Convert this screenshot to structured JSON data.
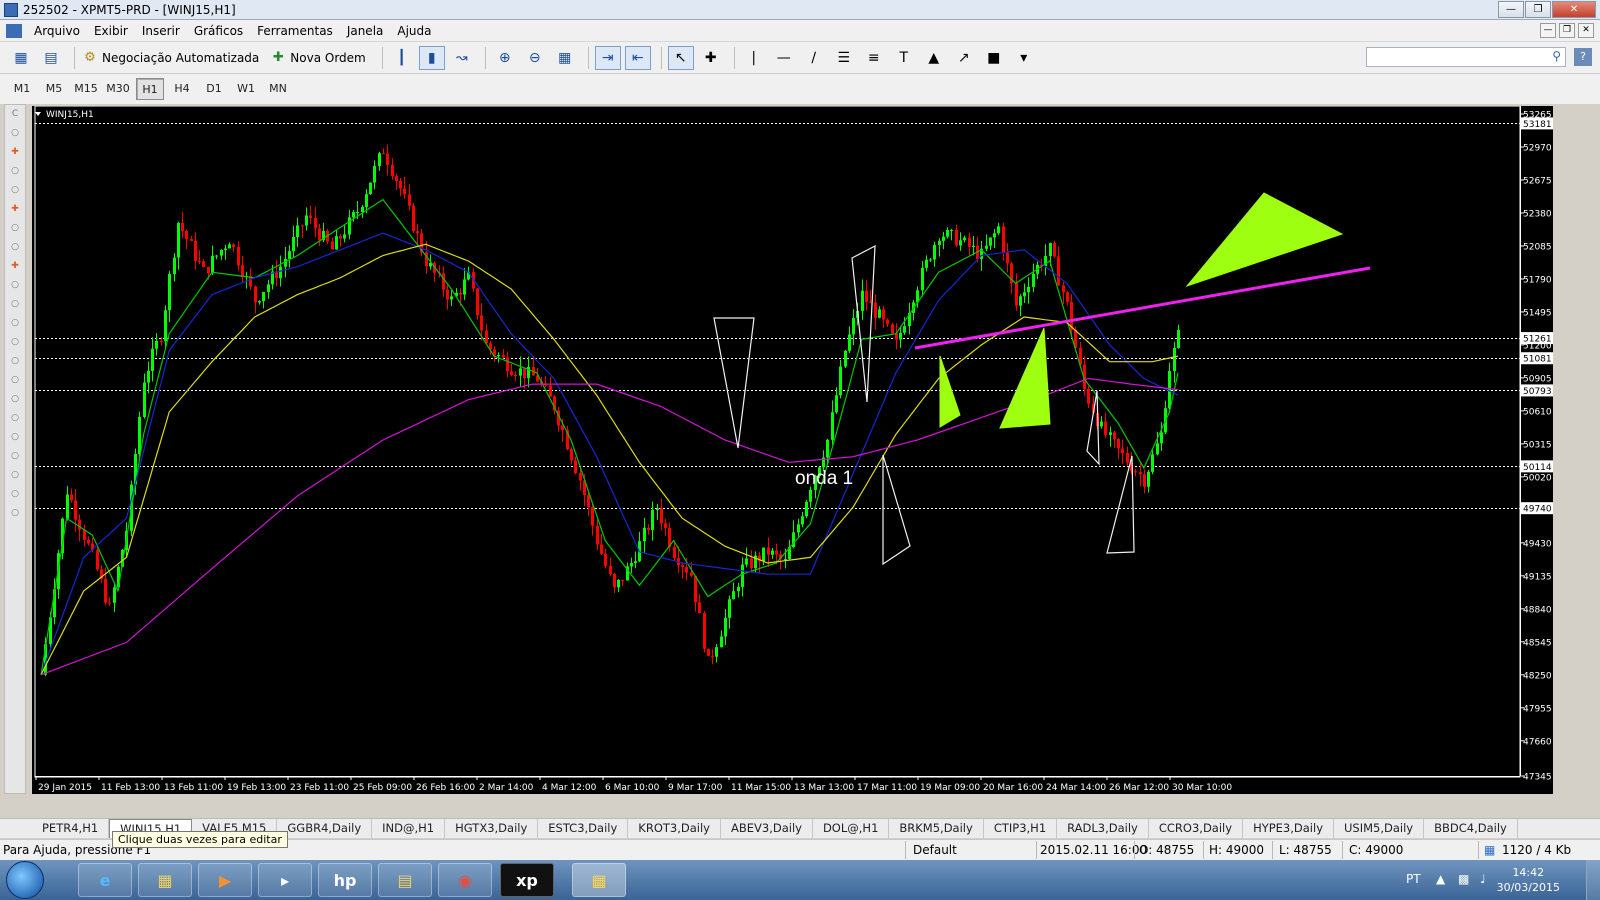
{
  "window": {
    "title": "252502 - XPMT5-PRD - [WINJ15,H1]"
  },
  "menu": [
    "Arquivo",
    "Exibir",
    "Inserir",
    "Gráficos",
    "Ferramentas",
    "Janela",
    "Ajuda"
  ],
  "toolbar": {
    "auto_trading": "Negociação Automatizada",
    "new_order": "Nova Ordem"
  },
  "timeframes": [
    "M1",
    "M5",
    "M15",
    "M30",
    "H1",
    "H4",
    "D1",
    "W1",
    "MN"
  ],
  "active_timeframe": "H1",
  "chart_data": {
    "type": "candlestick",
    "title": "WINJ15,H1",
    "symbol": "WINJ15",
    "timeframe": "H1",
    "ylim": [
      47345,
      53265
    ],
    "y_ticks": [
      53265,
      52970,
      52675,
      52380,
      52085,
      51790,
      51495,
      51200,
      50905,
      50610,
      50315,
      50020,
      49725,
      49430,
      49135,
      48840,
      48545,
      48250,
      47955,
      47660,
      47345
    ],
    "price_labels": [
      53181,
      51261,
      51081,
      50793,
      50114,
      49740
    ],
    "x_labels": [
      "29 Jan 2015",
      "11 Feb 13:00",
      "13 Feb 11:00",
      "19 Feb 13:00",
      "23 Feb 11:00",
      "25 Feb 09:00",
      "26 Feb 16:00",
      "2 Mar 14:00",
      "4 Mar 12:00",
      "6 Mar 10:00",
      "9 Mar 17:00",
      "11 Mar 15:00",
      "13 Mar 13:00",
      "17 Mar 11:00",
      "19 Mar 09:00",
      "20 Mar 16:00",
      "24 Mar 14:00",
      "26 Mar 12:00",
      "30 Mar 10:00"
    ],
    "close_path": [
      [
        0,
        48250
      ],
      [
        6,
        49900
      ],
      [
        12,
        49300
      ],
      [
        16,
        48840
      ],
      [
        20,
        49550
      ],
      [
        24,
        50900
      ],
      [
        28,
        51300
      ],
      [
        32,
        52300
      ],
      [
        38,
        51850
      ],
      [
        44,
        52150
      ],
      [
        50,
        51600
      ],
      [
        56,
        51900
      ],
      [
        62,
        52350
      ],
      [
        68,
        52050
      ],
      [
        74,
        52400
      ],
      [
        80,
        52950
      ],
      [
        84,
        52600
      ],
      [
        90,
        51950
      ],
      [
        96,
        51600
      ],
      [
        100,
        51800
      ],
      [
        104,
        51200
      ],
      [
        110,
        51000
      ],
      [
        116,
        50900
      ],
      [
        120,
        50650
      ],
      [
        126,
        50000
      ],
      [
        130,
        49450
      ],
      [
        134,
        49000
      ],
      [
        138,
        49250
      ],
      [
        144,
        49750
      ],
      [
        148,
        49350
      ],
      [
        152,
        49150
      ],
      [
        156,
        48350
      ],
      [
        160,
        48750
      ],
      [
        164,
        49200
      ],
      [
        170,
        49350
      ],
      [
        174,
        49250
      ],
      [
        180,
        49950
      ],
      [
        184,
        50350
      ],
      [
        188,
        51150
      ],
      [
        192,
        51650
      ],
      [
        196,
        51450
      ],
      [
        200,
        51200
      ],
      [
        204,
        51650
      ],
      [
        210,
        52200
      ],
      [
        214,
        52150
      ],
      [
        220,
        52000
      ],
      [
        224,
        52250
      ],
      [
        228,
        51550
      ],
      [
        232,
        51850
      ],
      [
        236,
        52050
      ],
      [
        240,
        51550
      ],
      [
        244,
        50800
      ],
      [
        248,
        50450
      ],
      [
        252,
        50250
      ],
      [
        258,
        50000
      ],
      [
        262,
        50400
      ],
      [
        264,
        51000
      ],
      [
        266,
        51280
      ]
    ],
    "moving_averages": [
      {
        "name": "MA green",
        "color": "#00c800",
        "path": [
          [
            0,
            48250
          ],
          [
            6,
            49650
          ],
          [
            12,
            49500
          ],
          [
            18,
            49000
          ],
          [
            24,
            50400
          ],
          [
            30,
            51300
          ],
          [
            40,
            51850
          ],
          [
            50,
            51800
          ],
          [
            60,
            52000
          ],
          [
            70,
            52250
          ],
          [
            80,
            52500
          ],
          [
            86,
            52200
          ],
          [
            96,
            51700
          ],
          [
            106,
            51100
          ],
          [
            116,
            50950
          ],
          [
            124,
            50350
          ],
          [
            132,
            49450
          ],
          [
            140,
            49050
          ],
          [
            148,
            49450
          ],
          [
            156,
            48950
          ],
          [
            164,
            49150
          ],
          [
            172,
            49250
          ],
          [
            180,
            49600
          ],
          [
            186,
            50400
          ],
          [
            192,
            51250
          ],
          [
            200,
            51300
          ],
          [
            210,
            51850
          ],
          [
            220,
            52050
          ],
          [
            228,
            51750
          ],
          [
            236,
            51950
          ],
          [
            244,
            50900
          ],
          [
            252,
            50500
          ],
          [
            258,
            50100
          ],
          [
            264,
            50600
          ],
          [
            266,
            50950
          ]
        ]
      },
      {
        "name": "MA blue",
        "color": "#1428d2",
        "path": [
          [
            0,
            48250
          ],
          [
            10,
            49300
          ],
          [
            20,
            49650
          ],
          [
            30,
            51150
          ],
          [
            40,
            51650
          ],
          [
            50,
            51800
          ],
          [
            60,
            51900
          ],
          [
            70,
            52050
          ],
          [
            80,
            52200
          ],
          [
            90,
            52050
          ],
          [
            100,
            51850
          ],
          [
            110,
            51300
          ],
          [
            120,
            50900
          ],
          [
            130,
            50200
          ],
          [
            140,
            49350
          ],
          [
            150,
            49250
          ],
          [
            160,
            49200
          ],
          [
            170,
            49150
          ],
          [
            180,
            49150
          ],
          [
            190,
            50050
          ],
          [
            200,
            50950
          ],
          [
            210,
            51600
          ],
          [
            220,
            52000
          ],
          [
            230,
            52050
          ],
          [
            240,
            51750
          ],
          [
            250,
            51200
          ],
          [
            258,
            50900
          ],
          [
            266,
            50750
          ]
        ]
      },
      {
        "name": "MA yellow",
        "color": "#dcdc14",
        "path": [
          [
            0,
            48250
          ],
          [
            10,
            49000
          ],
          [
            20,
            49300
          ],
          [
            30,
            50600
          ],
          [
            40,
            51050
          ],
          [
            50,
            51450
          ],
          [
            60,
            51650
          ],
          [
            70,
            51800
          ],
          [
            80,
            52000
          ],
          [
            90,
            52100
          ],
          [
            100,
            51950
          ],
          [
            110,
            51700
          ],
          [
            120,
            51250
          ],
          [
            130,
            50750
          ],
          [
            140,
            50150
          ],
          [
            150,
            49650
          ],
          [
            160,
            49400
          ],
          [
            170,
            49250
          ],
          [
            180,
            49300
          ],
          [
            190,
            49750
          ],
          [
            200,
            50400
          ],
          [
            210,
            50900
          ],
          [
            220,
            51200
          ],
          [
            230,
            51450
          ],
          [
            240,
            51400
          ],
          [
            250,
            51050
          ],
          [
            260,
            51050
          ],
          [
            266,
            51100
          ]
        ]
      },
      {
        "name": "MA magenta",
        "color": "#d214d2",
        "path": [
          [
            0,
            48250
          ],
          [
            20,
            48540
          ],
          [
            40,
            49200
          ],
          [
            60,
            49850
          ],
          [
            80,
            50350
          ],
          [
            100,
            50710
          ],
          [
            115,
            50850
          ],
          [
            130,
            50850
          ],
          [
            145,
            50650
          ],
          [
            160,
            50350
          ],
          [
            175,
            50150
          ],
          [
            190,
            50200
          ],
          [
            205,
            50350
          ],
          [
            220,
            50550
          ],
          [
            235,
            50750
          ],
          [
            245,
            50900
          ],
          [
            255,
            50850
          ],
          [
            266,
            50800
          ]
        ]
      }
    ],
    "annotations": [
      {
        "type": "text",
        "text": "onda 1"
      },
      {
        "type": "trendline",
        "color": "#f020f0"
      }
    ]
  },
  "symbol_tabs": [
    "PETR4,H1",
    "WINJ15,H1",
    "VALE5,M15",
    "GGBR4,Daily",
    "IND@,H1",
    "HGTX3,Daily",
    "ESTC3,Daily",
    "KROT3,Daily",
    "ABEV3,Daily",
    "DOL@,H1",
    "BRKM5,Daily",
    "CTIP3,H1",
    "RADL3,Daily",
    "CCRO3,Daily",
    "HYPE3,Daily",
    "USIM5,Daily",
    "BBDC4,Daily"
  ],
  "active_tab": "WINJ15,H1",
  "tooltip": "Clique duas vezes para editar",
  "status": {
    "help": "Para Ajuda, pressione F1",
    "profile": "Default",
    "datetime": "2015.02.11 16:00",
    "open": "O: 48755",
    "high": "H: 49000",
    "low": "L: 48755",
    "close": "C: 49000",
    "traffic": "1120 / 4 Kb"
  },
  "taskbar": {
    "language": "PT",
    "time": "14:42",
    "date": "30/03/2015",
    "xp_label": "xp"
  }
}
